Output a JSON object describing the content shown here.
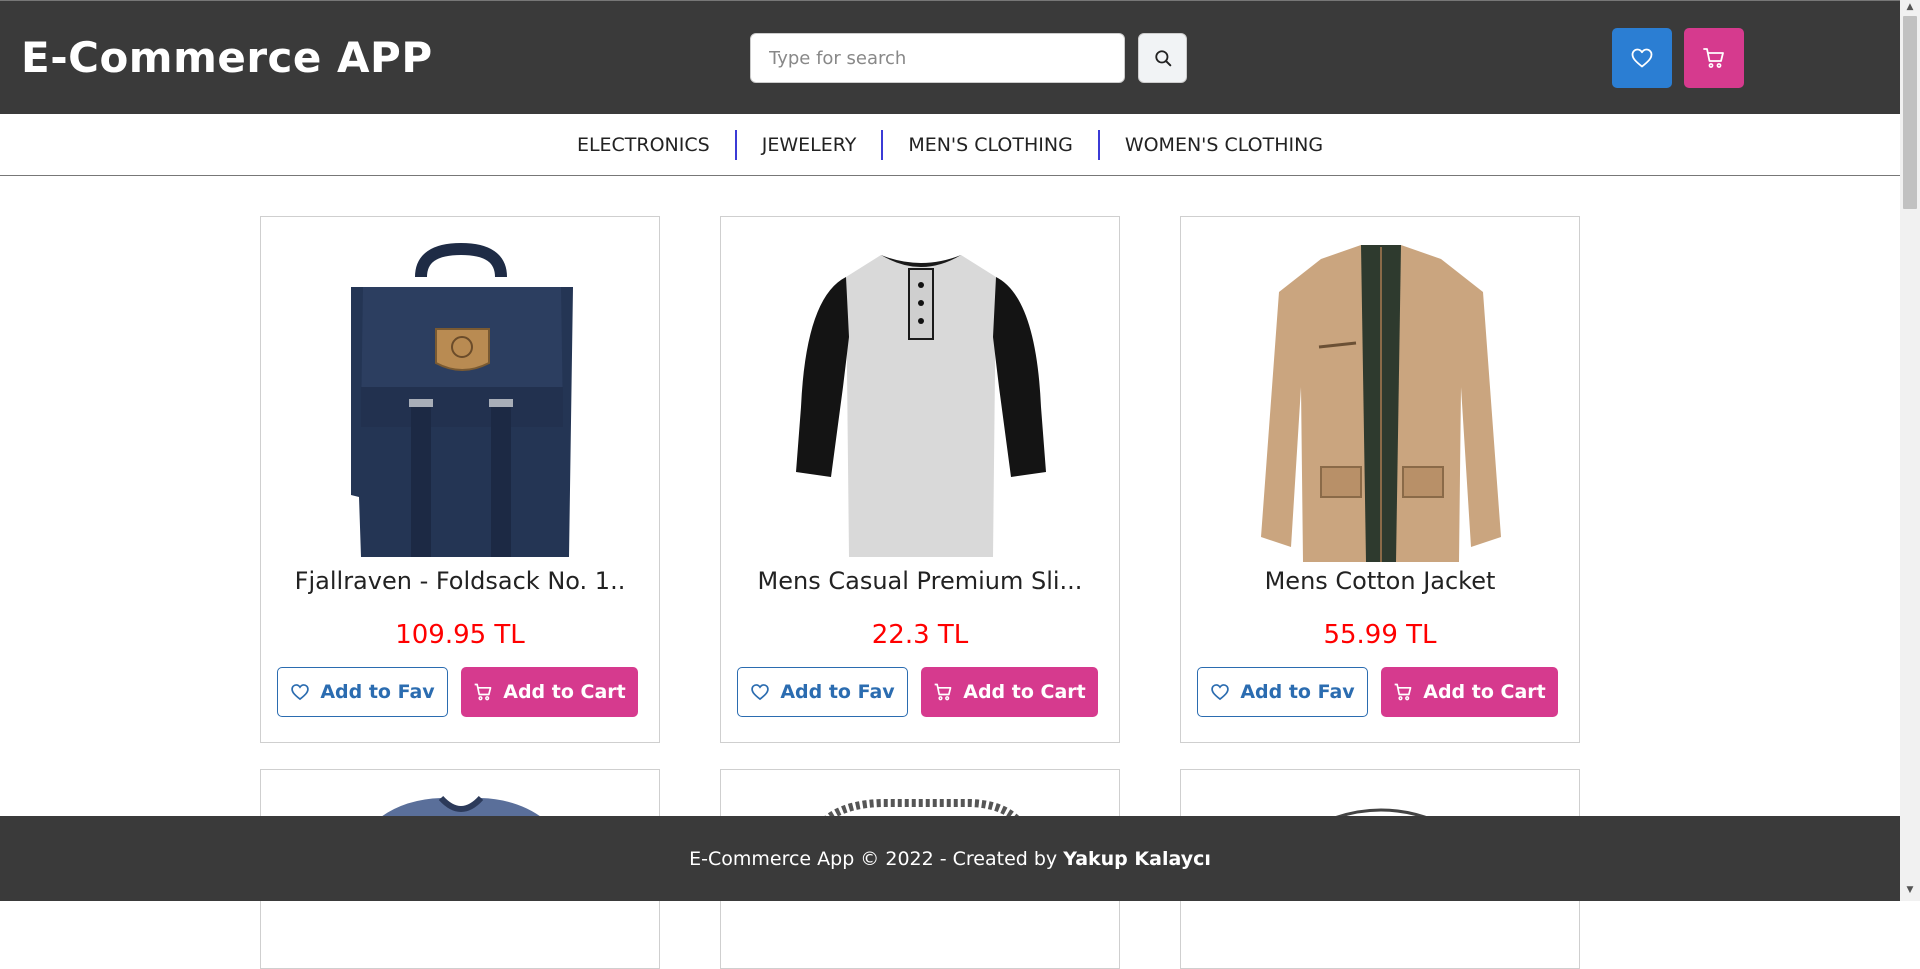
{
  "header": {
    "brand": "E-Commerce APP",
    "search_placeholder": "Type for search",
    "icons": {
      "search": "search-icon",
      "favorites": "heart-icon",
      "cart": "cart-icon"
    },
    "colors": {
      "background": "#3a3a3a",
      "fav_button": "#2b7ed3",
      "cart_button": "#d63a8e"
    }
  },
  "categories": [
    "ELECTRONICS",
    "JEWELERY",
    "MEN'S CLOTHING",
    "WOMEN'S CLOTHING"
  ],
  "products": [
    {
      "title": "Fjallraven - Foldsack No. 1..",
      "price": "109.95 TL",
      "fav_label": "Add to Fav",
      "cart_label": "Add to Cart"
    },
    {
      "title": "Mens Casual Premium Sli...",
      "price": "22.3 TL",
      "fav_label": "Add to Fav",
      "cart_label": "Add to Cart"
    },
    {
      "title": "Mens Cotton Jacket",
      "price": "55.99 TL",
      "fav_label": "Add to Fav",
      "cart_label": "Add to Cart"
    }
  ],
  "footer": {
    "text": "E-Commerce App © 2022 - Created by",
    "author": "Yakup Kalaycı"
  },
  "colors": {
    "price": "#ff0000",
    "accent_pink": "#d63a8e",
    "outline_blue": "#2b6cb0"
  }
}
